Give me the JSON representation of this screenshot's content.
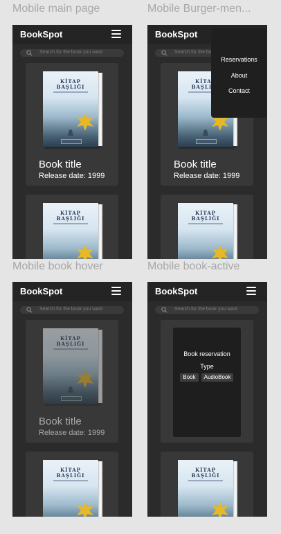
{
  "frames": [
    {
      "label": "Mobile main page"
    },
    {
      "label": "Mobile Burger-men..."
    },
    {
      "label": "Mobile book hover"
    },
    {
      "label": "Mobile book-active"
    }
  ],
  "header": {
    "logo": "BookSpot"
  },
  "search": {
    "placeholder": "Search for the book you want"
  },
  "book": {
    "cover_title_line1": "KİTAP",
    "cover_title_line2": "BAŞLIĞI",
    "title": "Book title",
    "release": "Release date: 1999"
  },
  "menu": {
    "items": [
      "Reservations",
      "About",
      "Contact"
    ]
  },
  "reservation": {
    "title": "Book reservation",
    "type_label": "Type",
    "options": [
      "Book",
      "AudioBook"
    ]
  },
  "colors": {
    "canvas": "#e5e5e5",
    "phone_bg": "#2b2b2b",
    "topbar": "#242424",
    "card": "#383838",
    "text": "#ffffff",
    "label": "#a8a8a8"
  }
}
